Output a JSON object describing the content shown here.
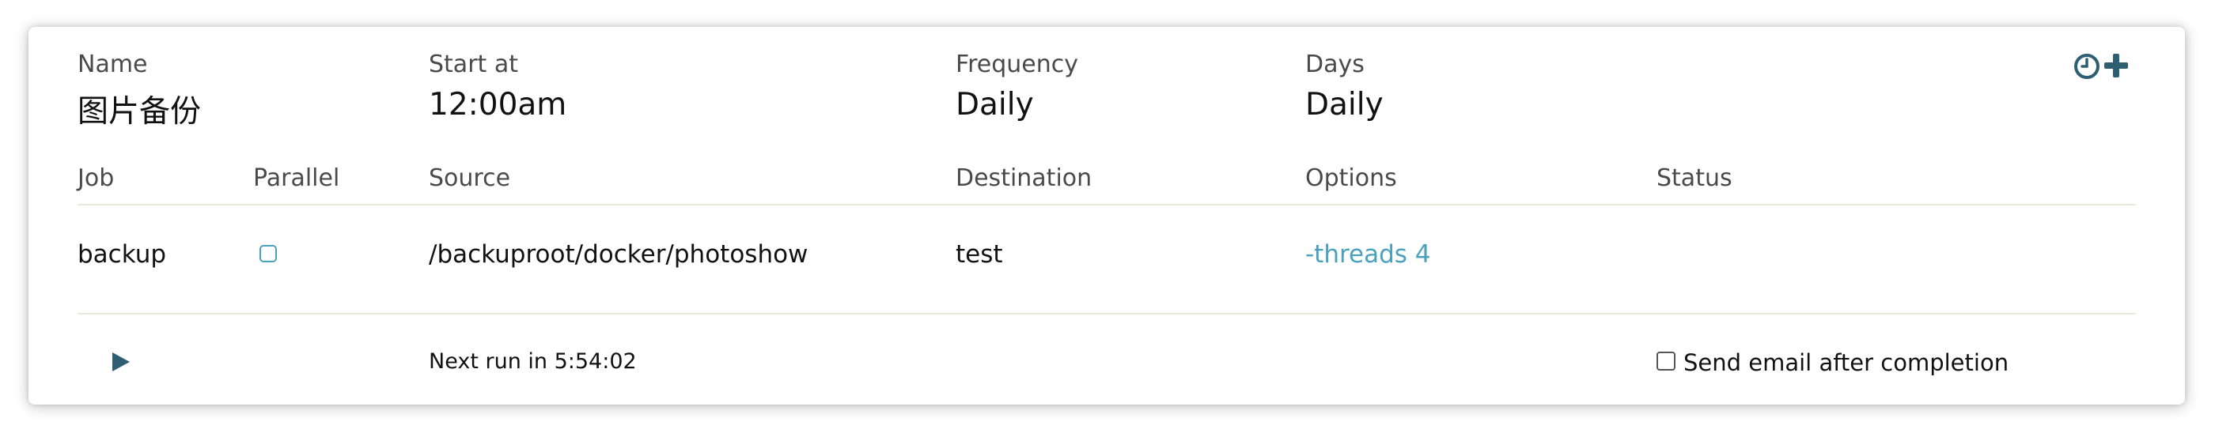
{
  "schedule": {
    "name_label": "Name",
    "name_value": "图片备份",
    "start_label": "Start at",
    "start_value": "12:00am",
    "frequency_label": "Frequency",
    "frequency_value": "Daily",
    "days_label": "Days",
    "days_value": "Daily"
  },
  "icons": {
    "clock": "clock-icon",
    "add": "plus-icon",
    "play": "play-icon",
    "accent": "#2e5e72"
  },
  "table": {
    "headers": {
      "job": "Job",
      "parallel": "Parallel",
      "source": "Source",
      "destination": "Destination",
      "options": "Options",
      "status": "Status"
    },
    "rows": [
      {
        "job": "backup",
        "parallel": false,
        "source": "/backuproot/docker/photoshow",
        "destination": "test",
        "options": "-threads 4",
        "status": ""
      }
    ]
  },
  "footer": {
    "next_run": "Next run in 5:54:02",
    "email_label": "Send email after completion",
    "email_checked": false
  },
  "colors": {
    "option_link": "#4aa1bd",
    "divider": "#e6ecd9"
  }
}
